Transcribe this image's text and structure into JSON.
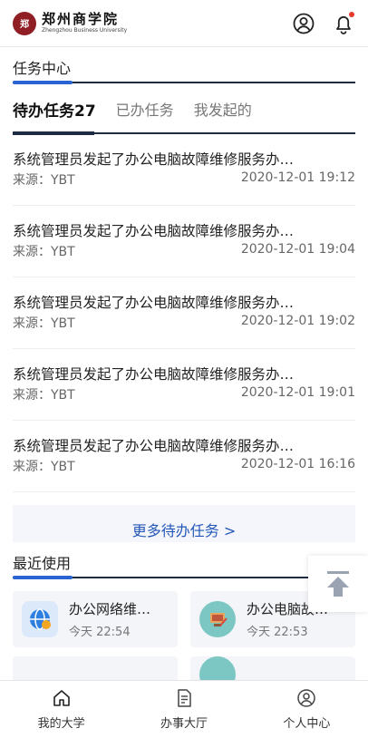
{
  "header": {
    "school_name_cn": "郑州商学院",
    "school_name_en": "Zhengzhou Business University",
    "icons": {
      "user": "user-circle-icon",
      "bell": "bell-icon"
    },
    "accent_color": "#2b62d3"
  },
  "task_center": {
    "title": "任务中心",
    "tabs": [
      {
        "label": "待办任务27",
        "active": true
      },
      {
        "label": "已办任务",
        "active": false
      },
      {
        "label": "我发起的",
        "active": false
      }
    ],
    "tasks": [
      {
        "title": "系统管理员发起了办公电脑故障维修服务办…",
        "source": "来源：YBT",
        "time": "2020-12-01 19:12"
      },
      {
        "title": "系统管理员发起了办公电脑故障维修服务办…",
        "source": "来源：YBT",
        "time": "2020-12-01 19:04"
      },
      {
        "title": "系统管理员发起了办公电脑故障维修服务办…",
        "source": "来源：YBT",
        "time": "2020-12-01 19:02"
      },
      {
        "title": "系统管理员发起了办公电脑故障维修服务办…",
        "source": "来源：YBT",
        "time": "2020-12-01 19:01"
      },
      {
        "title": "系统管理员发起了办公电脑故障维修服务办…",
        "source": "来源：YBT",
        "time": "2020-12-01 16:16"
      }
    ],
    "more_label": "更多待办任务 >"
  },
  "recent": {
    "title": "最近使用",
    "items": [
      {
        "name": "办公网络维…",
        "time": "今天 22:54",
        "icon": "network-globe-icon"
      },
      {
        "name": "办公电脑故…",
        "time": "今天 22:53",
        "icon": "computer-repair-icon"
      }
    ]
  },
  "bottom_nav": [
    {
      "label": "我的大学",
      "icon": "home-icon"
    },
    {
      "label": "办事大厅",
      "icon": "document-icon"
    },
    {
      "label": "个人中心",
      "icon": "user-circle-icon"
    }
  ]
}
